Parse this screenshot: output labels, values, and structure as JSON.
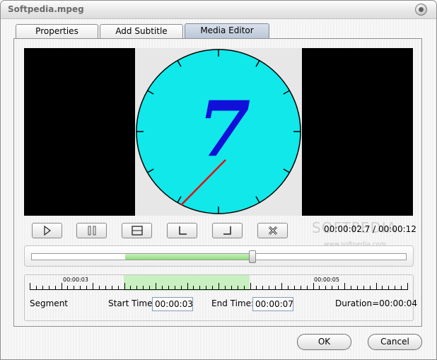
{
  "window": {
    "title": "Softpedia.mpeg"
  },
  "tabs": [
    {
      "label": "Properties"
    },
    {
      "label": "Add Subtitle"
    },
    {
      "label": "Media Editor"
    }
  ],
  "preview": {
    "digit": "7",
    "watermark": "SOFTPEDIA"
  },
  "controls": {
    "buttons": [
      "play-icon",
      "pause-icon",
      "stop-icon",
      "mark-start-icon",
      "mark-end-icon",
      "delete-segment-icon"
    ],
    "timecode": "00:00:02.7 / 00:00:12"
  },
  "watermark_url": "www.softpedia.com",
  "slider": {
    "selection_start": 0.25,
    "selection_end": 0.59
  },
  "timeline": {
    "labels": [
      "00:00:03",
      "00:00:05"
    ],
    "selection_start": "00:00:03",
    "selection_end": "00:00:07"
  },
  "segment": {
    "label": "Segment",
    "start_label": "Start Time:",
    "start_value": "00:00:03",
    "end_label": "End Time:",
    "end_value": "00:00:07",
    "duration": "Duration=00:00:04"
  },
  "footer": {
    "ok": "OK",
    "cancel": "Cancel"
  }
}
